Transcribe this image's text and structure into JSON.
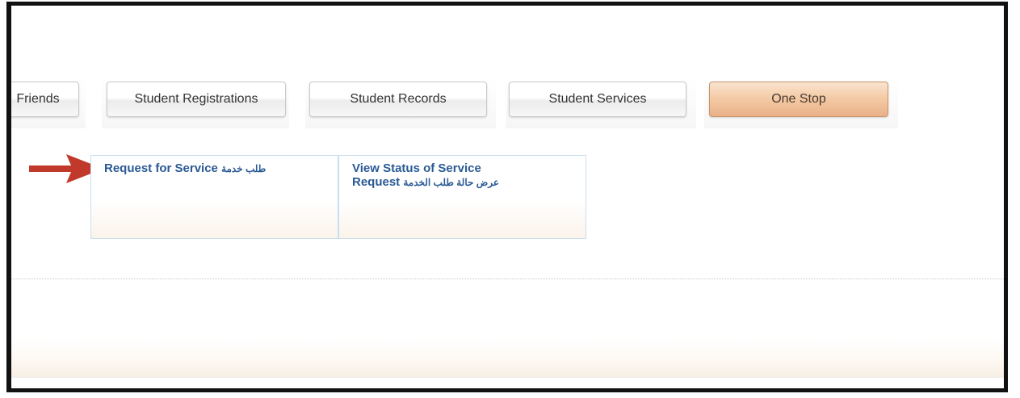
{
  "tabs": [
    {
      "label": "Friends",
      "active": false
    },
    {
      "label": "Student Registrations",
      "active": false
    },
    {
      "label": "Student Records",
      "active": false
    },
    {
      "label": "Student Services",
      "active": false
    },
    {
      "label": "One Stop",
      "active": true
    }
  ],
  "services": [
    {
      "title": "Request for Service",
      "arabic": "طلب خدمة"
    },
    {
      "title_line1": "View Status of Service",
      "title_line2": "Request",
      "arabic": "عرض حالة طلب الخدمة"
    }
  ],
  "colors": {
    "link": "#2a5a94",
    "active_tab": "#f3c9a3",
    "arrow": "#c0392b"
  },
  "icons": {
    "arrow": "red-arrow-right-icon"
  }
}
